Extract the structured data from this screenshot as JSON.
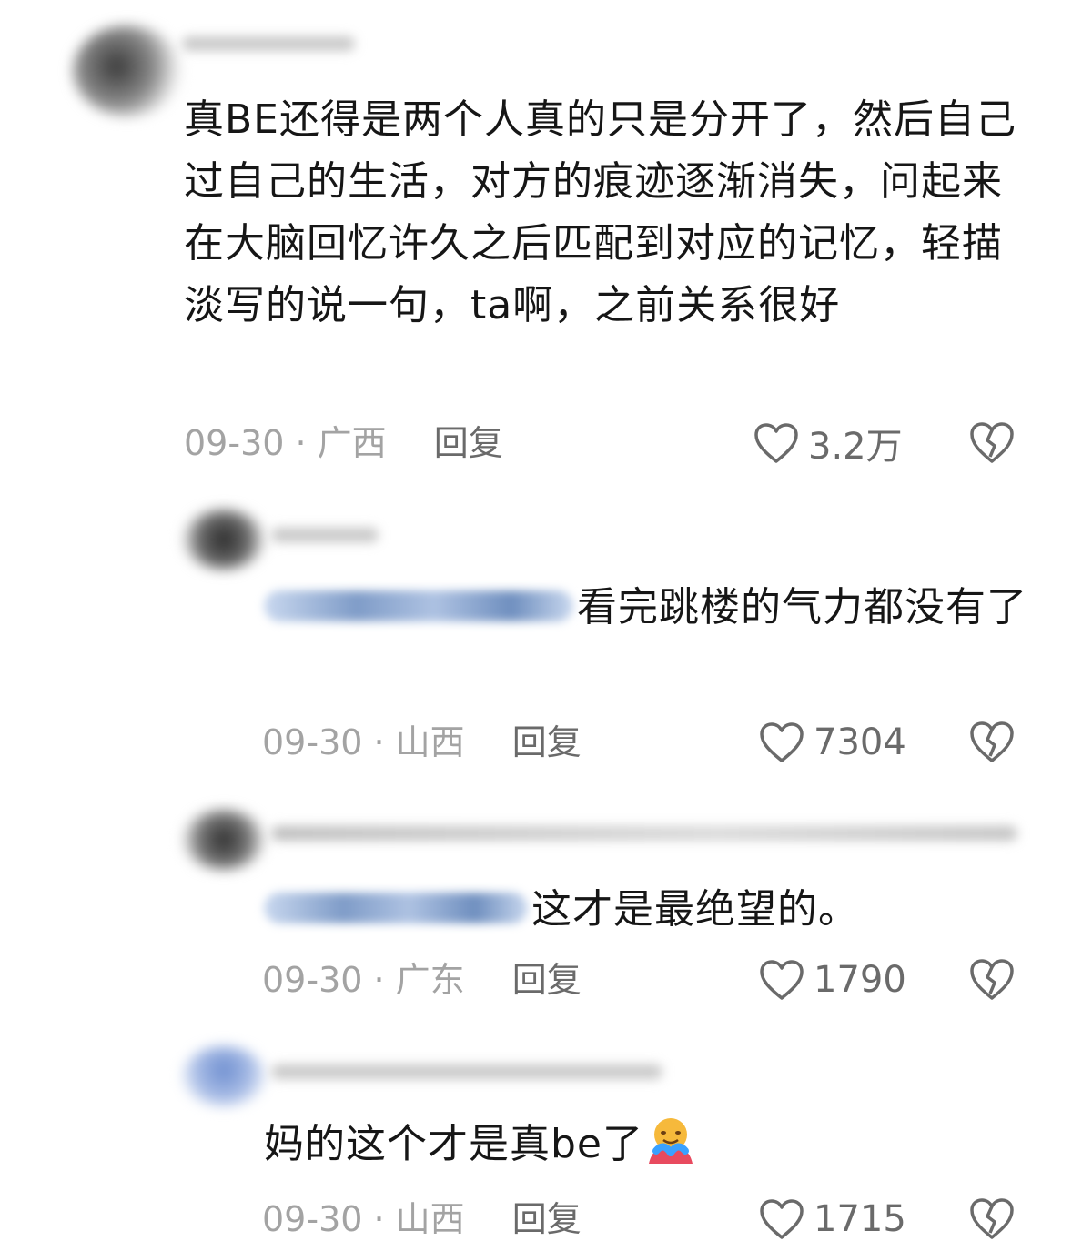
{
  "comments": [
    {
      "text": "真BE还得是两个人真的只是分开了，然后自己过自己的生活，对方的痕迹逐渐消失，问起来在大脑回忆许久之后匹配到对应的记忆，轻描淡写的说一句，ta啊，之前关系很好",
      "date": "09-30",
      "location": "广西",
      "reply_label": "回复",
      "likes": "3.2万"
    },
    {
      "text": "看完跳楼的气力都没有了",
      "date": "09-30",
      "location": "山西",
      "reply_label": "回复",
      "likes": "7304"
    },
    {
      "text": "这才是最绝望的。",
      "date": "09-30",
      "location": "广东",
      "reply_label": "回复",
      "likes": "1790"
    },
    {
      "text": "妈的这个才是真be了",
      "date": "09-30",
      "location": "山西",
      "reply_label": "回复",
      "likes": "1715"
    }
  ],
  "separator": " · ",
  "icons": {
    "like": "heart-outline-icon",
    "dislike": "broken-heart-icon",
    "emoji": "hugging-face-emoji"
  },
  "colors": {
    "text": "#161616",
    "meta": "#a3a3a3",
    "action": "#6a6a6a"
  }
}
